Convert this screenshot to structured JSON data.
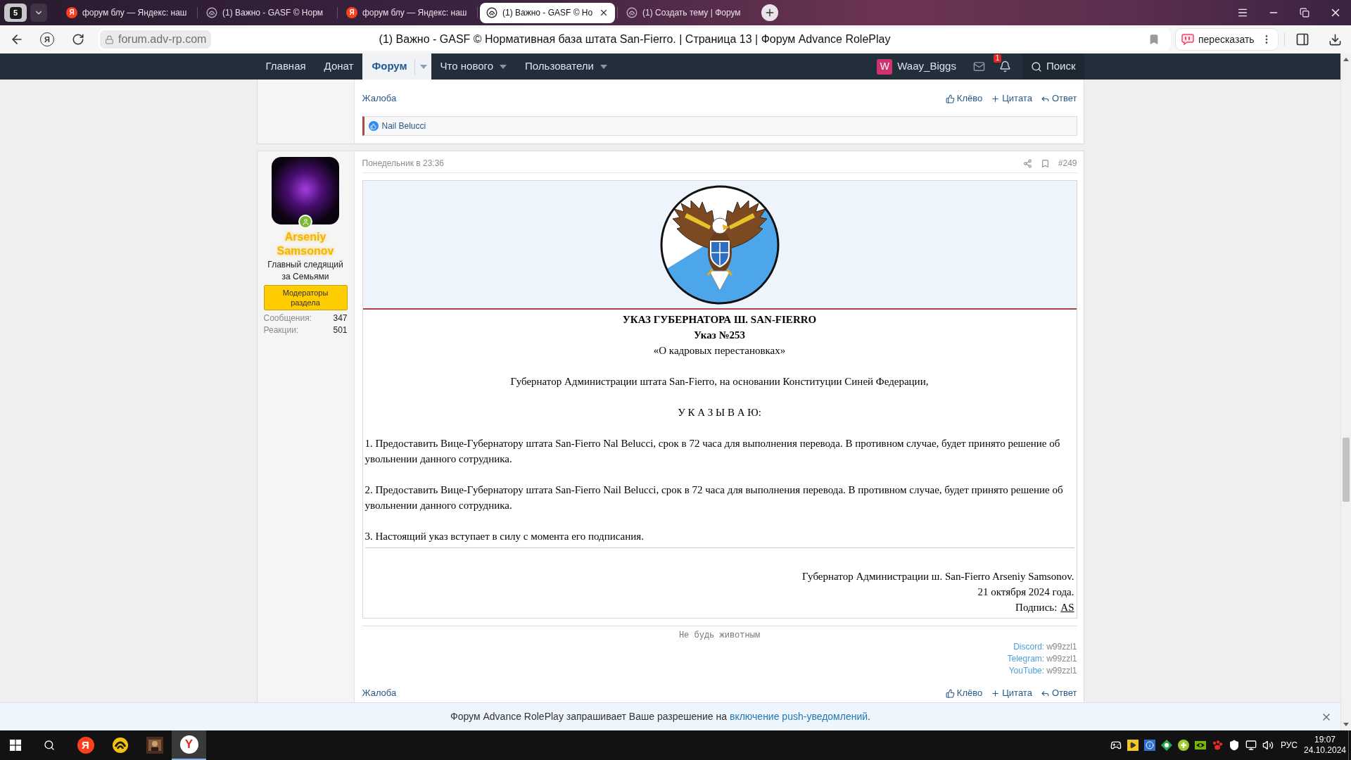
{
  "browser": {
    "tab_counter": "5",
    "tabs": [
      {
        "kind": "search",
        "icon": "Я",
        "title": "форум блу — Яндекс: наш",
        "selected": false
      },
      {
        "kind": "forum",
        "title": "(1) Важно - GASF © Норм",
        "selected": false
      },
      {
        "kind": "search",
        "icon": "Я",
        "title": "форум блу — Яндекс: наш",
        "selected": false
      },
      {
        "kind": "forum",
        "title": "(1) Важно - GASF © Но",
        "selected": true
      },
      {
        "kind": "forum",
        "title": "(1) Создать тему | Форум",
        "selected": false
      }
    ],
    "home_button": "Я",
    "address": "forum.adv-rp.com",
    "page_title": "(1) Важно - GASF © Нормативная база штата San-Fierro. | Страница 13 | Форум Advance RolePlay",
    "retell_button": "пересказать"
  },
  "nav": {
    "items": [
      {
        "label": "Главная",
        "selected": false,
        "dropdown": false
      },
      {
        "label": "Донат",
        "selected": false,
        "dropdown": false
      },
      {
        "label": "Форум",
        "selected": true,
        "dropdown": true
      },
      {
        "label": "Что нового",
        "selected": false,
        "dropdown": true
      },
      {
        "label": "Пользователи",
        "selected": false,
        "dropdown": true
      }
    ],
    "user": {
      "initial": "W",
      "name": "Waay_Biggs"
    },
    "alerts_badge": "1",
    "search": "Поиск"
  },
  "posts": [
    {
      "kind": "tail",
      "report": "Жалоба",
      "actions": [
        {
          "kind": "like",
          "label": "Клёво"
        },
        {
          "kind": "quote",
          "label": "Цитата"
        },
        {
          "kind": "reply",
          "label": "Ответ"
        }
      ],
      "reactions": "Nail Belucci"
    },
    {
      "kind": "full",
      "author": {
        "name": "Arseniy Samsonov",
        "title": "Главный следящий за Семьями",
        "badge": "Модераторы раздела",
        "online": true,
        "stats": [
          {
            "label": "Сообщения:",
            "value": "347"
          },
          {
            "label": "Реакции:",
            "value": "501"
          }
        ]
      },
      "date": "Понедельник в 23:36",
      "number": "#249",
      "body": {
        "heading": "УКАЗ ГУБЕРНАТОРА Ш. SAN-FIERRO",
        "number": "Указ №253",
        "subject": "«О кадровых перестановках»",
        "preamble": "Губернатор Администрации штата San-Fierro, на основании Конституции Синей Федерации,",
        "order": "У К А З Ы В А Ю:",
        "points": [
          "1. Предоставить Вице-Губернатору штата San-Fierro Nal Belucci, срок в 72 часа для выполнения перевода. В противном случае, будет принято решение об увольнении данного сотрудника.",
          "2. Предоставить Вице-Губернатору штата San-Fierro Nail Belucci, срок в 72 часа для выполнения перевода. В противном случае, будет принято решение об увольнении данного сотрудника.",
          "3. Настоящий указ вступает в силу с момента его подписания."
        ],
        "closing": [
          "Губернатор Администрации ш. San-Fierro Arseniy Samsonov.",
          "21 октября 2024 года."
        ],
        "signature_label": "Подпись:",
        "signature_mark": "AS"
      },
      "signature": {
        "motto": "Не будь животным",
        "contacts": [
          {
            "label": "Discord:",
            "value": "w99zzl1"
          },
          {
            "label": "Telegram:",
            "value": "w99zzl1"
          },
          {
            "label": "YouTube:",
            "value": "w99zzl1"
          }
        ]
      },
      "report": "Жалоба",
      "actions": [
        {
          "kind": "like",
          "label": "Клёво"
        },
        {
          "kind": "quote",
          "label": "Цитата"
        },
        {
          "kind": "reply",
          "label": "Ответ"
        }
      ]
    }
  ],
  "notification": {
    "text": "Форум Advance RolePlay запрашивает Ваше разрешение на",
    "link": "включение push-уведомлений",
    "end": "."
  },
  "taskbar": {
    "apps": [
      {
        "kind": "letter",
        "icon": "Я",
        "selected": false
      },
      {
        "kind": "swirl",
        "selected": false
      },
      {
        "kind": "game",
        "selected": false
      },
      {
        "kind": "browser",
        "icon": "Y",
        "selected": true
      }
    ],
    "language": "РУС",
    "time": "19:07",
    "date": "24.10.2024"
  }
}
